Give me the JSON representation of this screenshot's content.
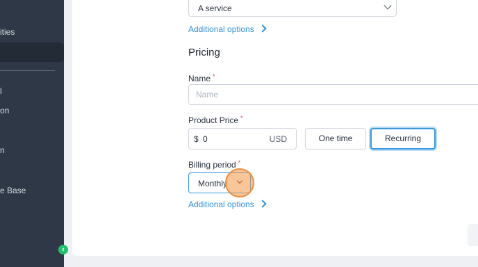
{
  "sidebar": {
    "items": [
      {
        "label": "ities"
      },
      {
        "label": "l"
      },
      {
        "label": "on"
      },
      {
        "label": "n"
      },
      {
        "label": "e Base"
      }
    ]
  },
  "form": {
    "top_select_value": "A service",
    "additional_options_1": "Additional options",
    "pricing_title": "Pricing",
    "name_label": "Name",
    "name_placeholder": "Name",
    "price_label": "Product Price",
    "currency_symbol": "$",
    "price_value": "0",
    "currency_unit": "USD",
    "one_time_label": "One time",
    "recurring_label": "Recurring",
    "billing_label": "Billing period",
    "billing_value": "Monthly",
    "additional_options_2": "Additional options",
    "required_mark": "*"
  },
  "colors": {
    "accent": "#2f8fdd",
    "sidebar_bg": "#2f3846",
    "toggle_green": "#22c06b",
    "cursor_orange": "#f08d3c",
    "required_red": "#e0473c"
  },
  "icons": {
    "select_chevron": "chevron-down-icon",
    "link_arrow": "chevron-right-icon",
    "collapse": "chevron-left-icon"
  }
}
